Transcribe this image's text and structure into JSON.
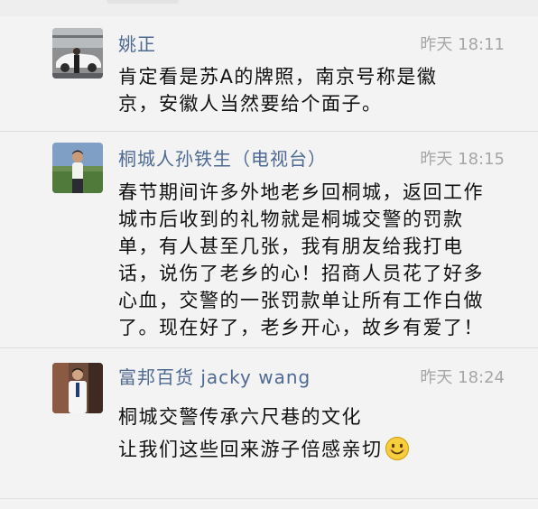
{
  "comments": [
    {
      "author": "姚正",
      "time": "昨天 18:11",
      "lines": [
        "肯定看是苏A的牌照，南京号称是徽",
        "京，安徽人当然要给个面子。"
      ]
    },
    {
      "author": "桐城人孙铁生（电视台）",
      "time": "昨天 18:15",
      "lines": [
        "春节期间许多外地老乡回桐城，返回工作",
        "城市后收到的礼物就是桐城交警的罚款",
        "单，有人甚至几张，我有朋友给我打电",
        "话，说伤了老乡的心！招商人员花了好多",
        "心血，交警的一张罚款单让所有工作白做",
        "了。现在好了，老乡开心，故乡有爱了！"
      ]
    },
    {
      "author": "富邦百货 jacky wang",
      "time": "昨天 18:24",
      "lines": [
        "桐城交警传承六尺巷的文化",
        "让我们这些回来游子倍感亲切"
      ],
      "emoji": "smiley-emoji"
    }
  ],
  "colors": {
    "name": "#4e6a93",
    "time": "#a6a6a6",
    "text": "#111111",
    "background": "#f3f3f3"
  }
}
